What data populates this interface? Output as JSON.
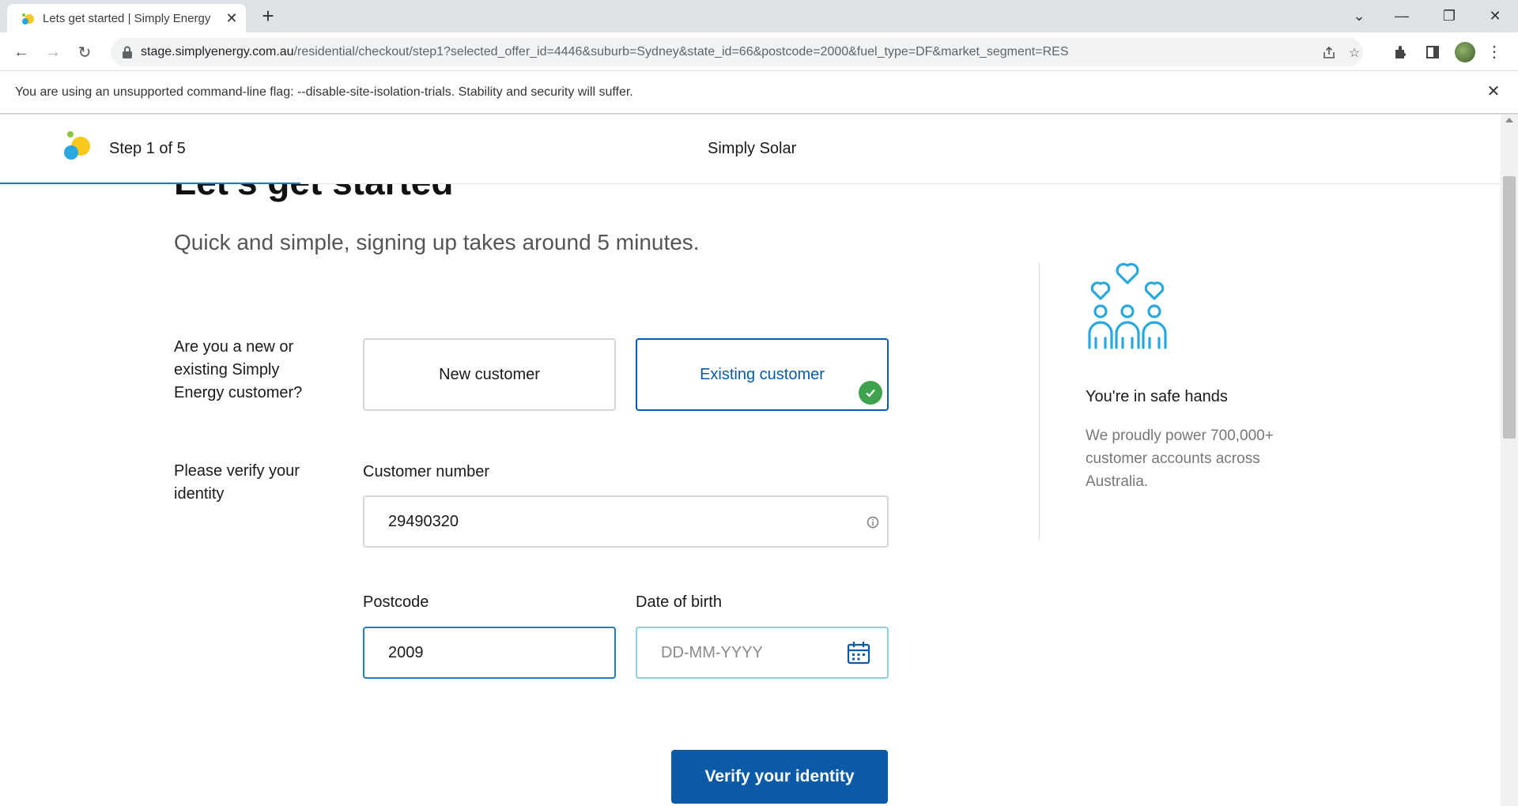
{
  "browser": {
    "tab_title": "Lets get started | Simply Energy",
    "url_domain": "stage.simplyenergy.com.au",
    "url_path": "/residential/checkout/step1?selected_offer_id=4446&suburb=Sydney&state_id=66&postcode=2000&fuel_type=DF&market_segment=RES",
    "infobar_message": "You are using an unsupported command-line flag: --disable-site-isolation-trials. Stability and security will suffer.",
    "icons": [
      "back-icon",
      "forward-icon",
      "reload-icon",
      "lock-icon",
      "share-icon",
      "star-icon",
      "extensions-icon",
      "sidepanel-icon",
      "kebab-menu-icon"
    ]
  },
  "header": {
    "step": "Step 1 of 5",
    "title": "Simply Solar"
  },
  "page": {
    "title": "Let's get started",
    "subtitle": "Quick and simple, signing up takes around 5 minutes."
  },
  "customer_type": {
    "question": "Are you a new or existing Simply Energy customer?",
    "options": [
      "New customer",
      "Existing customer"
    ],
    "selected": "Existing customer"
  },
  "verify": {
    "prompt": "Please verify your identity",
    "customer_number_label": "Customer number",
    "customer_number_value": "29490320",
    "postcode_label": "Postcode",
    "postcode_value": "2009",
    "dob_label": "Date of birth",
    "dob_placeholder": "DD-MM-YYYY",
    "button_label": "Verify your identity"
  },
  "sidebar": {
    "title": "You're in safe hands",
    "text": "We proudly power 700,000+ customer accounts across Australia."
  },
  "colors": {
    "brand_blue": "#0a5aa8",
    "accent_blue": "#1e7fc2",
    "success_green": "#3fa34d",
    "icon_cyan": "#29a8e0"
  }
}
